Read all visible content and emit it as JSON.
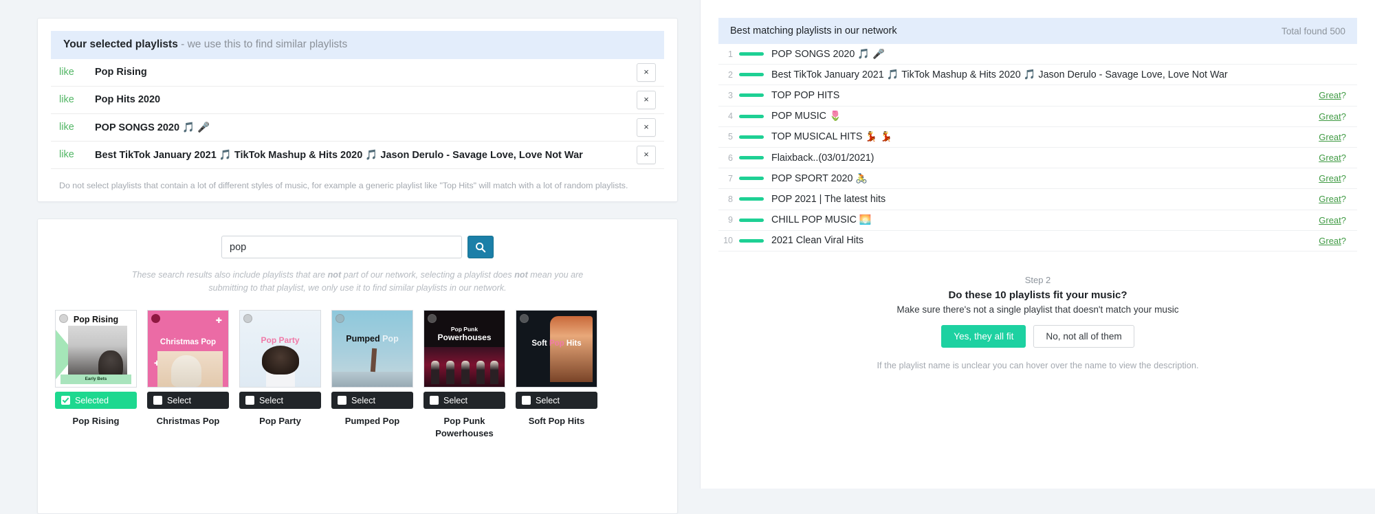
{
  "left": {
    "selected_panel": {
      "header_strong": "Your selected playlists",
      "header_muted": " - we use this to find similar playlists",
      "like_label": "like",
      "remove_label": "×",
      "rows": [
        {
          "title": "Pop Rising"
        },
        {
          "title": "Pop Hits 2020"
        },
        {
          "title": "POP SONGS 2020 🎵 🎤"
        },
        {
          "title": "Best TikTok January 2021 🎵 TikTok Mashup & Hits 2020 🎵 Jason Derulo - Savage Love, Love Not War"
        }
      ],
      "note": "Do not select playlists that contain a lot of different styles of music, for example a generic playlist like \"Top Hits\" will match with a lot of random playlists."
    },
    "search_panel": {
      "query": "pop",
      "placeholder": "",
      "search_icon": "search-icon",
      "note_part1": "These search results also include playlists that are ",
      "note_not1": "not",
      "note_part2": " part of our network, selecting a playlist does ",
      "note_not2": "not",
      "note_part3": " mean you are submitting to that playlist, we only use it to find similar playlists in our network.",
      "select_label": "Select",
      "selected_label": "Selected",
      "tiles": [
        {
          "name": "Pop Rising",
          "cover_title": "Pop Rising",
          "cover_sub": "Early Bets",
          "selected": true
        },
        {
          "name": "Christmas Pop",
          "cover_title": "Christmas Pop",
          "selected": false
        },
        {
          "name": "Pop Party",
          "cover_title": "Pop Party",
          "selected": false
        },
        {
          "name": "Pumped Pop",
          "cover_title_dark": "Pumped",
          "cover_title_light": "Pop",
          "selected": false
        },
        {
          "name": "Pop Punk Powerhouses",
          "cover_line1": "Pop Punk",
          "cover_line2": "Powerhouses",
          "selected": false
        },
        {
          "name": "Soft Pop Hits",
          "cover_a": "Soft ",
          "cover_b": "Pop",
          "cover_c": " Hits",
          "selected": false
        }
      ]
    }
  },
  "right": {
    "header": {
      "title": "Best matching playlists in our network",
      "total": "Total found 500"
    },
    "great_label": "Great",
    "great_suffix": "?",
    "matches": [
      {
        "index": "1",
        "title": "POP SONGS 2020 🎵 🎤",
        "great": false
      },
      {
        "index": "2",
        "title": "Best TikTok January 2021 🎵 TikTok Mashup & Hits 2020 🎵 Jason Derulo - Savage Love, Love Not War",
        "great": false
      },
      {
        "index": "3",
        "title": "TOP POP HITS",
        "great": true
      },
      {
        "index": "4",
        "title": "POP MUSIC 🌷",
        "great": true
      },
      {
        "index": "5",
        "title": "TOP MUSICAL HITS 💃 💃",
        "great": true
      },
      {
        "index": "6",
        "title": "Flaixback..(03/01/2021)",
        "great": true
      },
      {
        "index": "7",
        "title": "POP SPORT 2020 🚴",
        "great": true
      },
      {
        "index": "8",
        "title": "POP 2021 | The latest hits",
        "great": true
      },
      {
        "index": "9",
        "title": "CHILL POP MUSIC 🌅",
        "great": true
      },
      {
        "index": "10",
        "title": "2021 Clean Viral Hits",
        "great": true
      }
    ],
    "step": {
      "label": "Step 2",
      "question": "Do these 10 playlists fit your music?",
      "subtitle": "Make sure there's not a single playlist that doesn't match your music",
      "yes_label": "Yes, they all fit",
      "no_label": "No, not all of them",
      "hint": "If the playlist name is unclear you can hover over the name to view the description."
    }
  },
  "colors": {
    "accent_green": "#1dd1a1",
    "bar_green": "#1ed094",
    "link_green": "#3f9a43",
    "header_blue": "#e3edfb",
    "search_blue": "#1b7fa8"
  }
}
